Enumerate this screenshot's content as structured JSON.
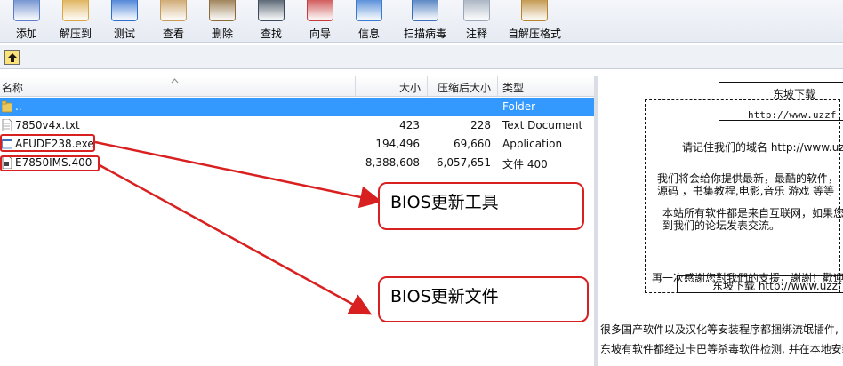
{
  "toolbar": {
    "buttons": [
      {
        "label": "添加",
        "icon": "add-books-icon",
        "color": "#5a7fc8"
      },
      {
        "label": "解压到",
        "icon": "extract-folder-icon",
        "color": "#d9a640"
      },
      {
        "label": "测试",
        "icon": "test-check-icon",
        "color": "#2f6ed1"
      },
      {
        "label": "查看",
        "icon": "view-book-icon",
        "color": "#c79b5a"
      },
      {
        "label": "删除",
        "icon": "delete-box-icon",
        "color": "#8c6b3a"
      },
      {
        "label": "查找",
        "icon": "binoculars-icon",
        "color": "#3a4a5a"
      },
      {
        "label": "向导",
        "icon": "wizard-icon",
        "color": "#c83a3a"
      },
      {
        "label": "信息",
        "icon": "info-icon",
        "color": "#3a7ad1"
      },
      {
        "label": "扫描病毒",
        "icon": "scan-virus-icon",
        "color": "#3a6fb8"
      },
      {
        "label": "注释",
        "icon": "comment-notepad-icon",
        "color": "#9aa7b8"
      },
      {
        "label": "自解压格式",
        "icon": "sfx-archive-icon",
        "color": "#b8852e"
      }
    ]
  },
  "columns": {
    "name": "名称",
    "size": "大小",
    "packed": "压缩后大小",
    "type": "类型"
  },
  "files": [
    {
      "name": "..",
      "size": "",
      "packed": "",
      "type": "Folder",
      "icon": "folder-up-icon"
    },
    {
      "name": "7850v4x.txt",
      "size": "423",
      "packed": "228",
      "type": "Text Document",
      "icon": "text-file-icon"
    },
    {
      "name": "AFUDE238.exe",
      "size": "194,496",
      "packed": "69,660",
      "type": "Application",
      "icon": "exe-file-icon"
    },
    {
      "name": "E7850IMS.400",
      "size": "8,388,608",
      "packed": "6,057,651",
      "type": "文件 400",
      "icon": "generic-file-icon"
    }
  ],
  "comment": {
    "site_title": "东坡下载",
    "url_top": "http://www.uzzf.co",
    "remember": "请记住我们的域名 http://www.uzz",
    "provide_1": "我们将会给你提供最新，最酷的软件，",
    "provide_2": "源码 ，书集教程,电影,音乐 游戏 等等",
    "source_1": "本站所有软件都是来自互联网，如果您",
    "source_2": "到我们的论坛发表交流。",
    "thanks": "再一次感謝您對我們的支援，謝謝！歡迎",
    "footer": "东坡下载 http://www.uzzf",
    "note_1": "很多国产软件以及汉化等安装程序都捆绑流氓插件,",
    "note_2": "东坡有软件都经过卡巴等杀毒软件检测, 并在本地安装"
  },
  "annotations": {
    "tool_label": "BIOS更新工具",
    "file_label": "BIOS更新文件",
    "color": "#d92020"
  }
}
